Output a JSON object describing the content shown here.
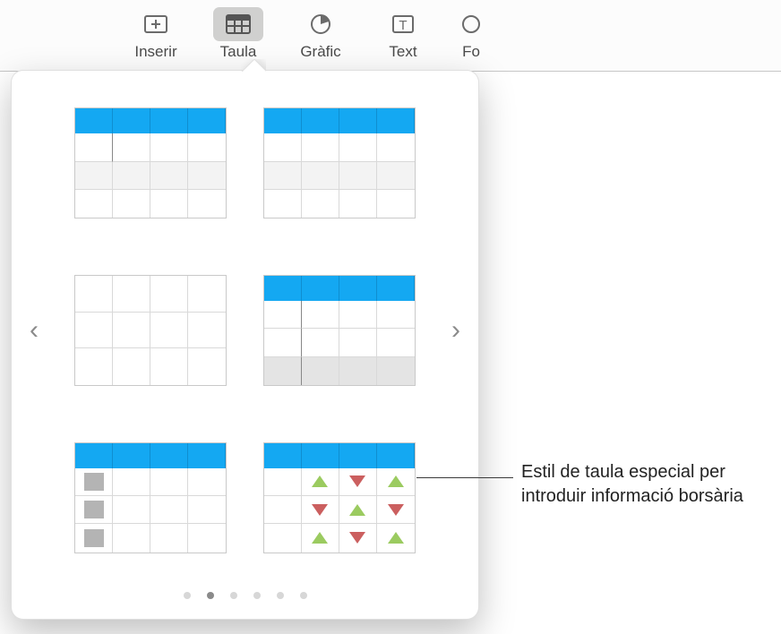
{
  "toolbar": {
    "items": [
      {
        "label": "Inserir",
        "icon": "insert"
      },
      {
        "label": "Taula",
        "icon": "table",
        "active": true
      },
      {
        "label": "Gràfic",
        "icon": "chart"
      },
      {
        "label": "Text",
        "icon": "text"
      },
      {
        "label": "Fo",
        "icon": "shape"
      }
    ]
  },
  "popover": {
    "page_count": 6,
    "active_page_index": 1,
    "styles": [
      {
        "id": "blue-header-cursor",
        "header": true,
        "variant": "style1"
      },
      {
        "id": "blue-header-basic",
        "header": true,
        "variant": "style2"
      },
      {
        "id": "plain-grid",
        "header": false,
        "variant": "style3"
      },
      {
        "id": "blue-header-footer",
        "header": true,
        "variant": "style4"
      },
      {
        "id": "blue-header-swatches",
        "header": true,
        "variant": "style5"
      },
      {
        "id": "blue-header-stock",
        "header": true,
        "variant": "style6"
      }
    ],
    "stock_arrows": [
      [
        "up",
        "down",
        "up"
      ],
      [
        "down",
        "up",
        "down"
      ],
      [
        "up",
        "down",
        "up"
      ]
    ]
  },
  "callout": {
    "text": "Estil de taula especial per introduir informació borsària"
  }
}
